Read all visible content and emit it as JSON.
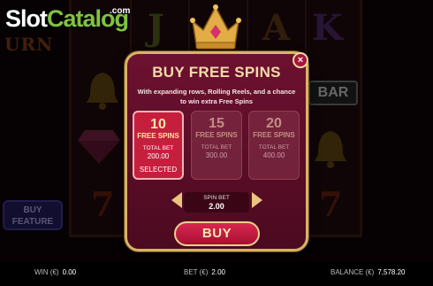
{
  "watermark": {
    "slot": "Slot",
    "catalog": "Catalog",
    "com": ".com"
  },
  "background": {
    "game_title_partial": "URN",
    "bar_symbol": "BAR",
    "buy_feature": [
      "BUY",
      "FEATURE"
    ],
    "symbols": [
      "J",
      "A",
      "K",
      "7",
      "7"
    ]
  },
  "dialog": {
    "title": "BUY FREE SPINS",
    "close": "×",
    "subtitle_line1": "With expanding rows, Rolling Reels, and a chance",
    "subtitle_line2": "to win extra Free Spins",
    "options": [
      {
        "count": "10",
        "label": "FREE SPINS",
        "total_bet_label": "TOTAL BET",
        "total_bet": "200.00",
        "status": "SELECTED"
      },
      {
        "count": "15",
        "label": "FREE SPINS",
        "total_bet_label": "TOTAL BET",
        "total_bet": "300.00"
      },
      {
        "count": "20",
        "label": "FREE SPINS",
        "total_bet_label": "TOTAL BET",
        "total_bet": "400.00"
      }
    ],
    "spin_bet_label": "SPIN BET",
    "spin_bet": "2.00",
    "buy_label": "BUY"
  },
  "status_bar": {
    "win_label": "WIN (€)",
    "win": "0.00",
    "bet_label": "BET (€)",
    "bet": "2.00",
    "balance_label": "BALANCE (€)",
    "balance": "7,578.20"
  },
  "colors": {
    "dialog_bg": "#6d1130",
    "gold_border": "#d9b267",
    "selected": "#c61f3e",
    "buy_button": "#c41c43"
  }
}
